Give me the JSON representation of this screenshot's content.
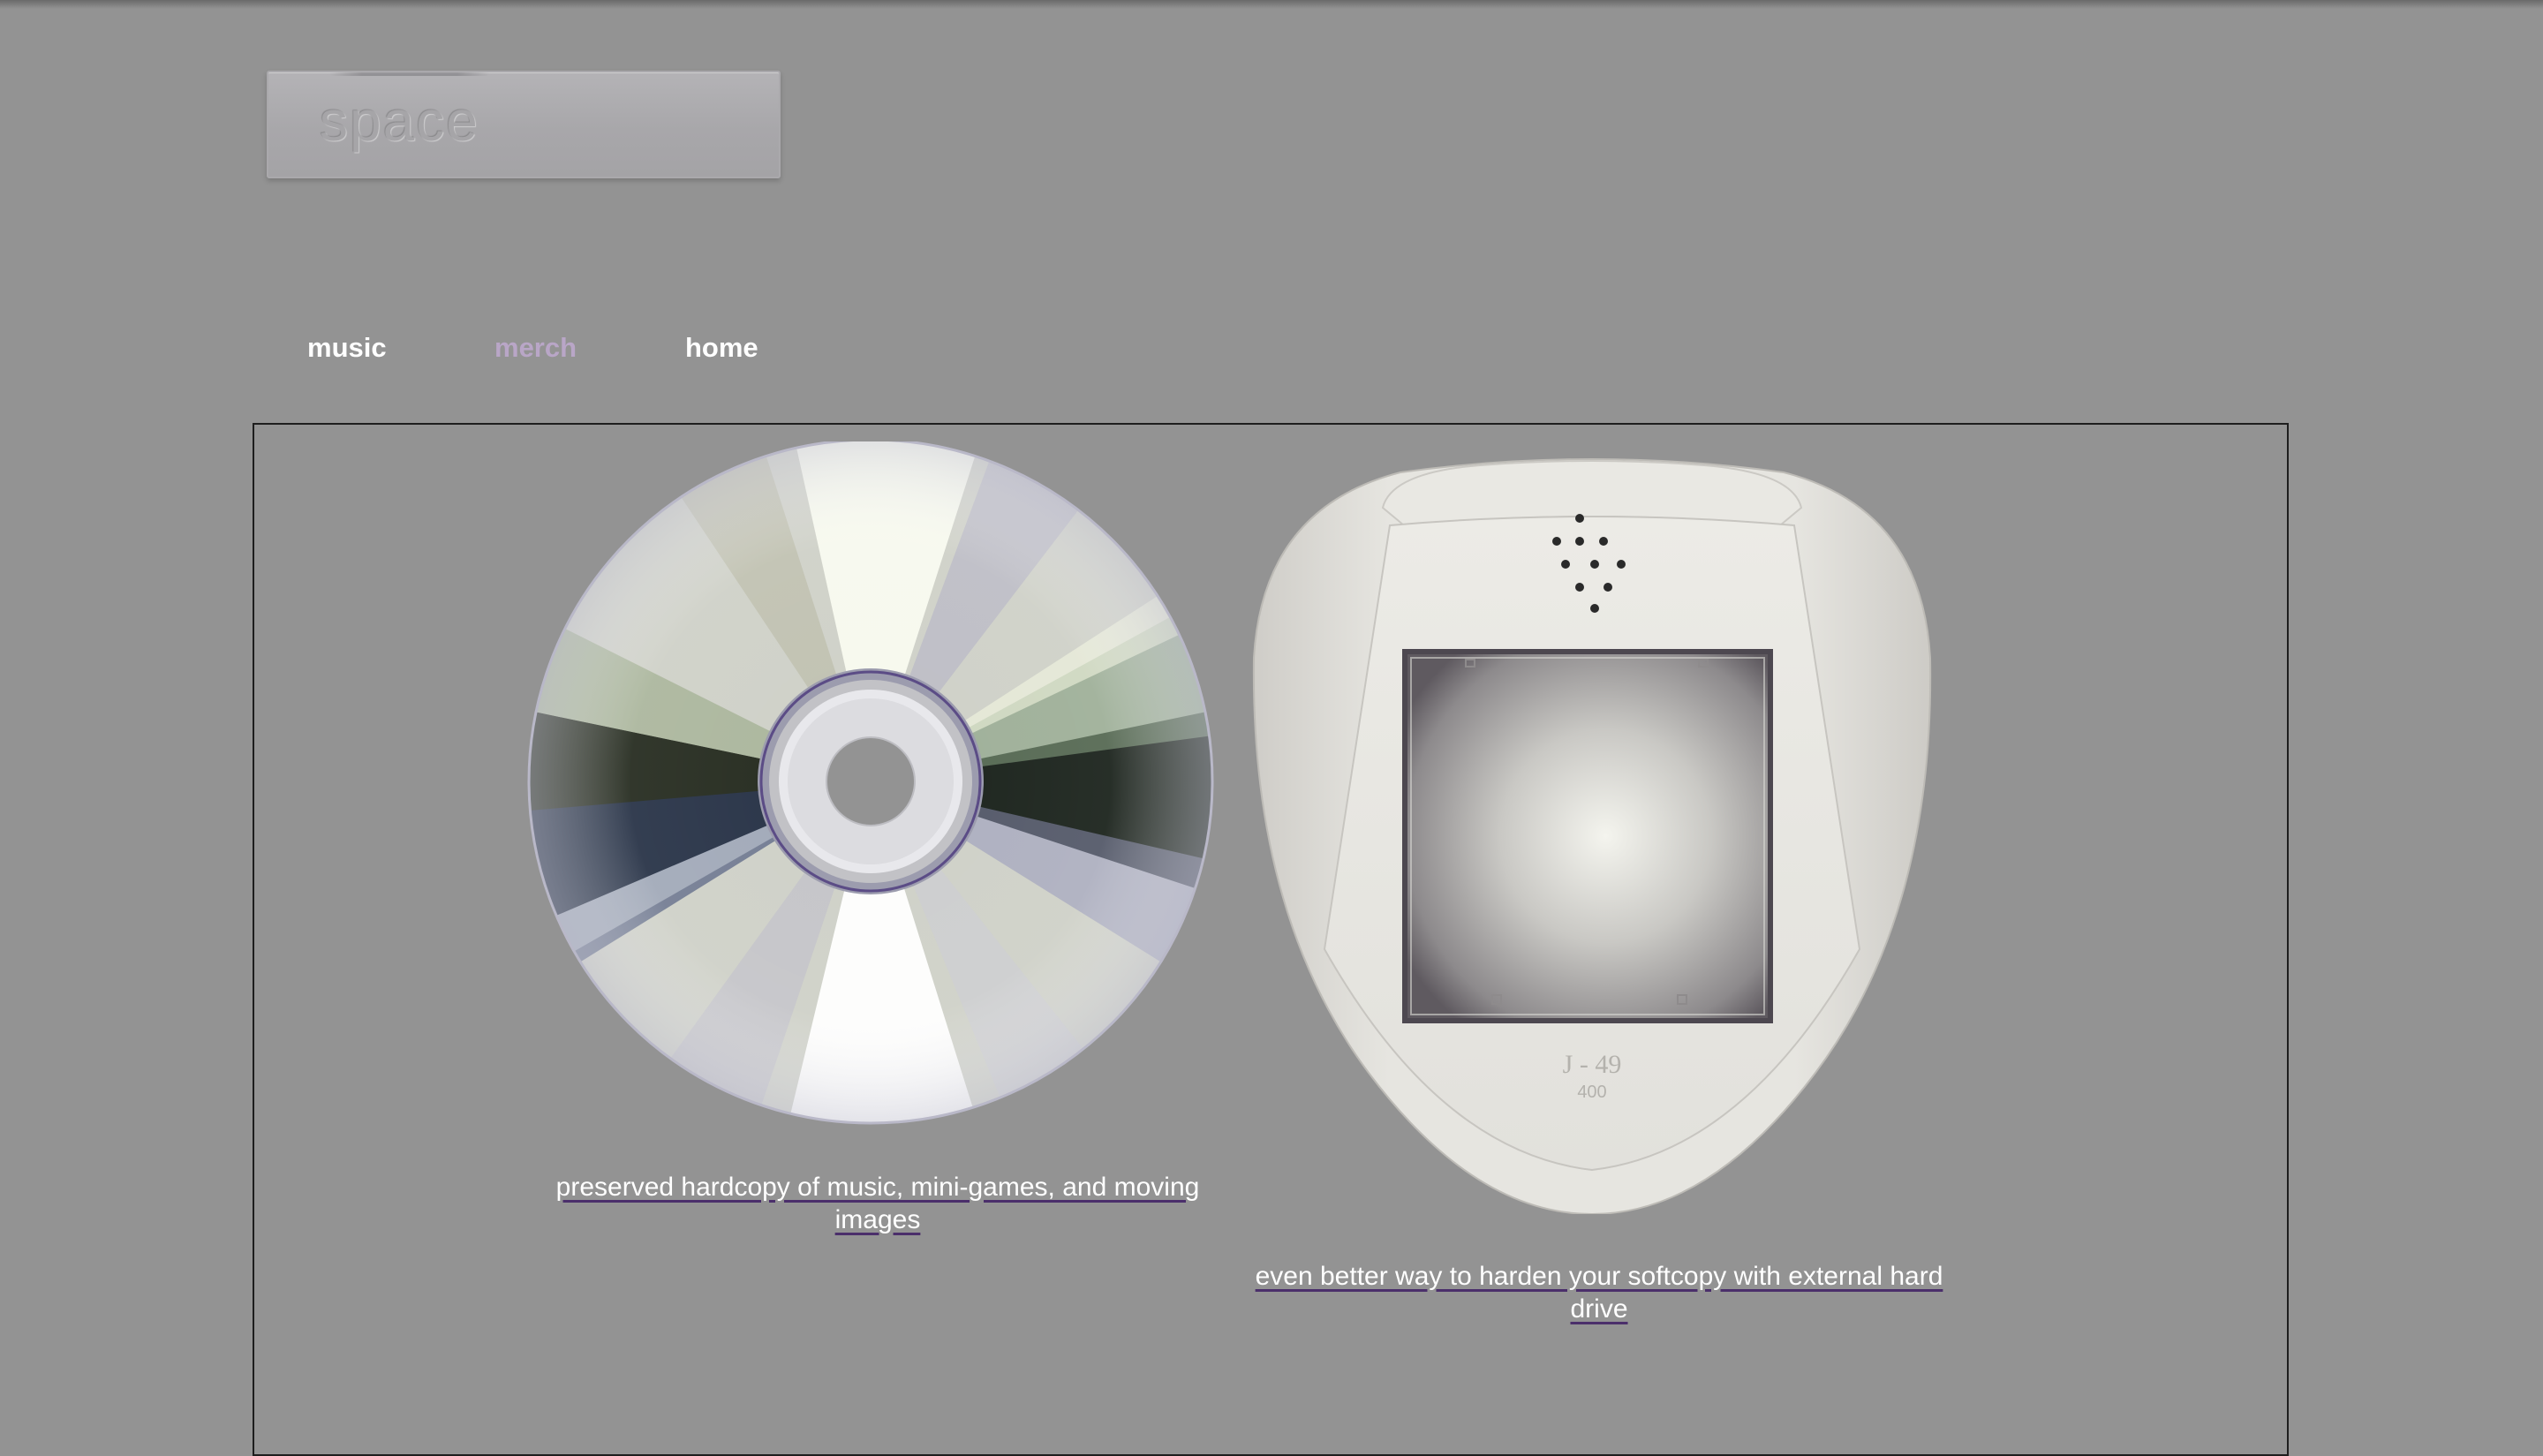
{
  "site": {
    "logo_text": "space"
  },
  "nav": {
    "items": [
      {
        "label": "music",
        "active": false
      },
      {
        "label": "merch",
        "active": true
      },
      {
        "label": "home",
        "active": false
      }
    ],
    "active_color": "#b9a6c7",
    "default_color": "#ffffff"
  },
  "products": [
    {
      "image": "cd-disc-image",
      "caption": "preserved hardcopy of music, mini-games, and moving images"
    },
    {
      "image": "external-hard-drive-image",
      "device_model": "J - 49",
      "device_subtext": "400",
      "caption": "even better way to harden your softcopy with external hard drive"
    }
  ],
  "colors": {
    "background": "#939393",
    "panel_border": "#1e1e1e",
    "underline": "#4b2f6b"
  }
}
